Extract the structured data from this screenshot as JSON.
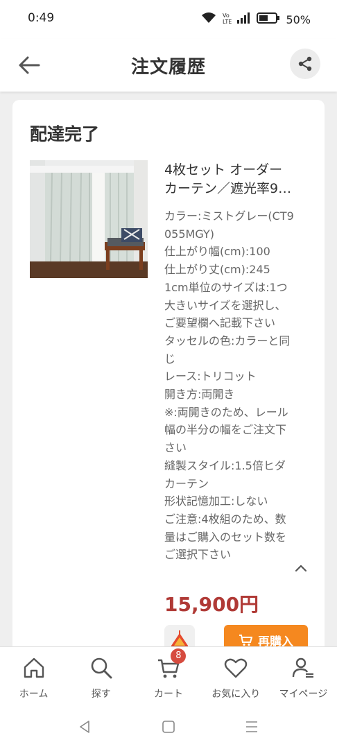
{
  "status_bar": {
    "time": "0:49",
    "battery_percent": "50%",
    "icons": [
      "wifi-icon",
      "volte-icon",
      "signal-icon",
      "battery-icon"
    ]
  },
  "header": {
    "title": "注文履歴",
    "back_icon": "arrow-left-icon",
    "share_icon": "share-icon"
  },
  "order": {
    "status": "配達完了",
    "product_name_line1": "4枚セット オーダー",
    "product_name_line2": "カーテン／遮光率9…",
    "options": [
      "カラー:ミストグレー(CT9055MGY)",
      "仕上がり幅(cm):100",
      "仕上がり丈(cm):245",
      "1cm単位のサイズは:1つ大きいサイズを選択し、ご要望欄へ記載下さい",
      "タッセルの色:カラーと同じ",
      "レース:トリコット",
      "開き方:両開き",
      "※:両開きのため、レール幅の半分の幅をご注文下さい",
      "縫製スタイル:1.5倍ヒダカーテン",
      "形状記憶加工:しない",
      "ご注意:4枚組のため、数量はご購入のセット数をご選択下さい"
    ],
    "price": "15,900円",
    "rebuy_label": "再購入"
  },
  "bottom_nav": {
    "items": [
      {
        "label": "ホーム",
        "icon": "home-icon"
      },
      {
        "label": "探す",
        "icon": "search-icon"
      },
      {
        "label": "カート",
        "icon": "cart-icon",
        "badge": "8"
      },
      {
        "label": "お気に入り",
        "icon": "heart-icon"
      },
      {
        "label": "マイページ",
        "icon": "user-icon"
      }
    ]
  },
  "colors": {
    "accent": "#f5881f",
    "price": "#b03a36",
    "badge": "#d64b3f"
  }
}
